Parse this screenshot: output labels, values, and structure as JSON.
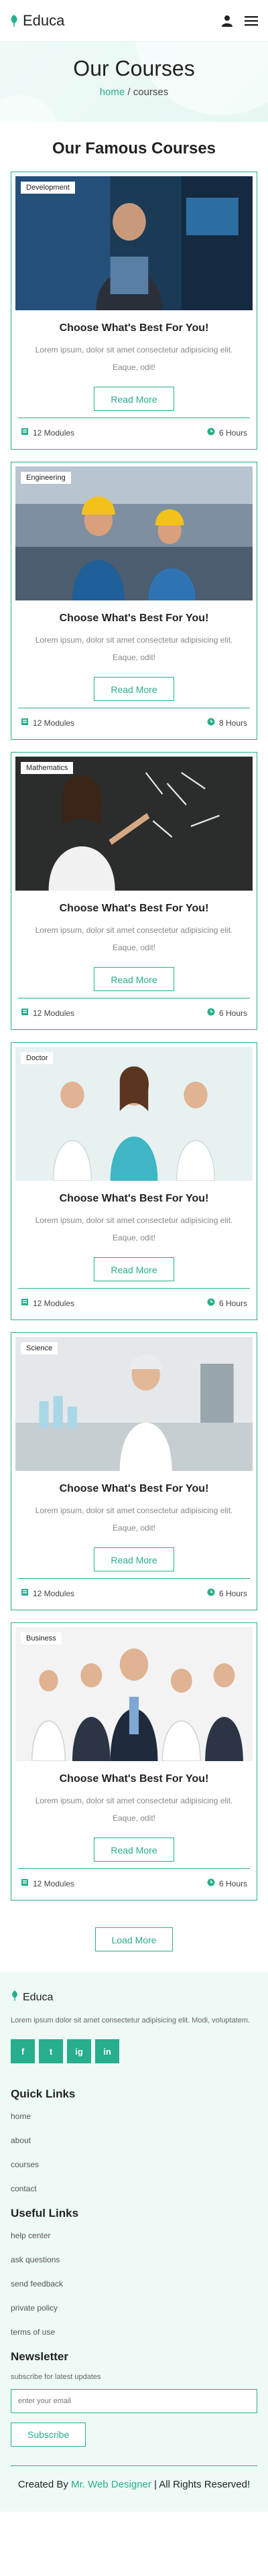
{
  "brand": {
    "name": "Educa"
  },
  "header": {
    "user_icon": "user-icon",
    "menu_icon": "menu-icon"
  },
  "hero": {
    "title": "Our Courses",
    "crumb_home": "home",
    "crumb_sep": " / ",
    "crumb_current": "courses"
  },
  "section": {
    "title": "Our Famous Courses"
  },
  "courses": [
    {
      "tag": "Development",
      "title": "Choose What's Best For You!",
      "desc": "Lorem ipsum, dolor sit amet consectetur adipisicing elit. Eaque, odit!",
      "button": "Read More",
      "modules": "12 Modules",
      "hours": "6 Hours"
    },
    {
      "tag": "Engineering",
      "title": "Choose What's Best For You!",
      "desc": "Lorem ipsum, dolor sit amet consectetur adipisicing elit. Eaque, odit!",
      "button": "Read More",
      "modules": "12 Modules",
      "hours": "8 Hours"
    },
    {
      "tag": "Mathematics",
      "title": "Choose What's Best For You!",
      "desc": "Lorem ipsum, dolor sit amet consectetur adipisicing elit. Eaque, odit!",
      "button": "Read More",
      "modules": "12 Modules",
      "hours": "6 Hours"
    },
    {
      "tag": "Doctor",
      "title": "Choose What's Best For You!",
      "desc": "Lorem ipsum, dolor sit amet consectetur adipisicing elit. Eaque, odit!",
      "button": "Read More",
      "modules": "12 Modules",
      "hours": "6 Hours"
    },
    {
      "tag": "Science",
      "title": "Choose What's Best For You!",
      "desc": "Lorem ipsum, dolor sit amet consectetur adipisicing elit. Eaque, odit!",
      "button": "Read More",
      "modules": "12 Modules",
      "hours": "6 Hours"
    },
    {
      "tag": "Business",
      "title": "Choose What's Best For You!",
      "desc": "Lorem ipsum, dolor sit amet consectetur adipisicing elit. Eaque, odit!",
      "button": "Read More",
      "modules": "12 Modules",
      "hours": "6 Hours"
    }
  ],
  "load_more": "Load More",
  "footer": {
    "brand": "Educa",
    "about": "Lorem ipsum dolor sit amet consectetur adipisicing elit. Modi, voluptatem.",
    "socials": [
      "f",
      "t",
      "ig",
      "in"
    ],
    "quick_links_title": "Quick Links",
    "quick_links": [
      "home",
      "about",
      "courses",
      "contact"
    ],
    "useful_links_title": "Useful Links",
    "useful_links": [
      "help center",
      "ask questions",
      "send feedback",
      "private policy",
      "terms of use"
    ],
    "newsletter_title": "Newsletter",
    "newsletter_note": "subscribe for latest updates",
    "email_placeholder": "enter your email",
    "subscribe": "Subscribe",
    "copyright_prefix": "Created By ",
    "copyright_author": "Mr. Web Designer",
    "copyright_suffix": " | All Rights Reserved!"
  },
  "colors": {
    "accent": "#27ae8c",
    "hero_bg": "#eefaf6"
  }
}
